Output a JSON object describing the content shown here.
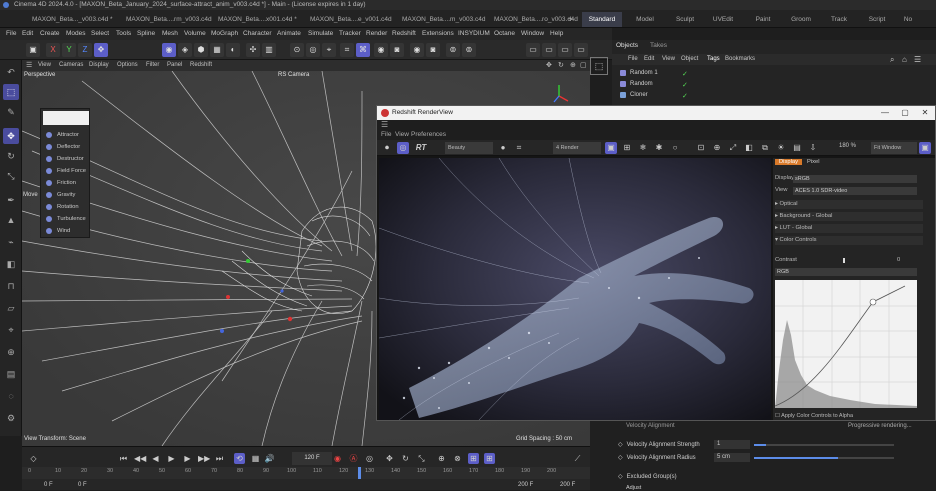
{
  "app": {
    "title": "Cinema 4D 2024.4.0 - [MAXON_Beta_January_2024_surface-attract_anim_v003.c4d *] - Main - (License expires in 1 day)"
  },
  "doc_tabs": [
    {
      "label": "MAXON_Beta..._v003.c4d *",
      "active": true
    },
    {
      "label": "MAXON_Beta....rm_v003.c4d",
      "active": false
    },
    {
      "label": "MAXON_Beta....x001.c4d *",
      "active": false
    },
    {
      "label": "MAXON_Beta....e_v001.c4d",
      "active": false
    },
    {
      "label": "MAXON_Beta....m_v003.c4d",
      "active": false
    },
    {
      "label": "MAXON_Beta....ro_v003.c4d",
      "active": false
    }
  ],
  "layout_tabs": [
    "Standard",
    "Model",
    "Sculpt",
    "UVEdit",
    "Paint",
    "Groom",
    "Track",
    "Script",
    "No"
  ],
  "menu": [
    "File",
    "Edit",
    "Create",
    "Modes",
    "Select",
    "Tools",
    "Spline",
    "Mesh",
    "Volume",
    "MoGraph",
    "Character",
    "Animate",
    "Simulate",
    "Tracker",
    "Render",
    "Redshift",
    "Extensions",
    "INSYDIUM",
    "Octane",
    "Window",
    "Help"
  ],
  "viewport": {
    "menu": [
      "View",
      "Cameras",
      "Display",
      "Options",
      "Filter",
      "Panel",
      "Redshift"
    ],
    "label": "Perspective",
    "camera": "RS Camera",
    "view_transform": "View Transform: Scene",
    "grid_spacing": "Grid Spacing : 50 cm"
  },
  "force_popup": {
    "items": [
      "Attractor",
      "Deflector",
      "Destructor",
      "Field Force",
      "Friction",
      "Gravity",
      "Rotation",
      "Turbulence",
      "Wind"
    ],
    "move_label": "Move"
  },
  "timeline": {
    "frame_field": "120 F",
    "ruler": [
      "0",
      "10",
      "20",
      "30",
      "40",
      "50",
      "60",
      "70",
      "80",
      "90",
      "100",
      "110",
      "120",
      "130",
      "140",
      "150",
      "160",
      "170",
      "180",
      "190",
      "200"
    ],
    "start": "0 F",
    "start2": "0 F",
    "end": "200 F",
    "end2": "200 F"
  },
  "object_manager": {
    "tabs": [
      "Objects",
      "Takes"
    ],
    "menu": [
      "File",
      "Edit",
      "View",
      "Object",
      "Tags",
      "Bookmarks"
    ],
    "rows": [
      "Random 1",
      "Random",
      "Cloner"
    ]
  },
  "renderview": {
    "title": "Redshift RenderView",
    "menu": [
      "File",
      "View",
      "Preferences"
    ],
    "rt_label": "RT",
    "beauty": "Beauty",
    "render_mode": "4 Render",
    "zoom": "180 %",
    "fit": "Fit Window",
    "panel_tabs": [
      "Display",
      "Pixel"
    ],
    "display_label": "Display",
    "display_value": "sRGB",
    "view_label": "View",
    "view_value": "ACES 1.0 SDR-video",
    "sections": [
      "Optical",
      "Background - Global",
      "LUT - Global",
      "Color Controls"
    ],
    "contrast_label": "Contrast",
    "contrast_value": "0",
    "rgb_value": "RGB",
    "apply_label": "Apply Color Controls to Alpha",
    "status": "Progressive rendering..."
  },
  "attributes": {
    "header": "Velocity Alignment",
    "strength_label": "Velocity Alignment Strength",
    "strength_value": "1",
    "radius_label": "Velocity Alignment Radius",
    "radius_value": "5 cm",
    "excluded_label": "Excluded Group(s)",
    "next_label": "Adjust"
  }
}
